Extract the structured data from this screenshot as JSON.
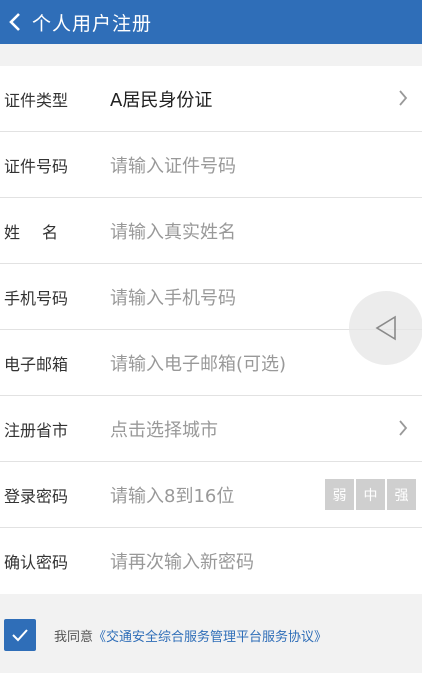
{
  "header": {
    "title": "个人用户注册"
  },
  "form": {
    "rows": [
      {
        "label": "证件类型",
        "value": "A居民身份证"
      },
      {
        "label": "证件号码",
        "placeholder": "请输入证件号码"
      },
      {
        "label": "姓名",
        "placeholder": "请输入真实姓名"
      },
      {
        "label": "手机号码",
        "placeholder": "请输入手机号码"
      },
      {
        "label": "电子邮箱",
        "placeholder": "请输入电子邮箱(可选)"
      },
      {
        "label": "注册省市",
        "placeholder": "点击选择城市"
      },
      {
        "label": "登录密码",
        "placeholder": "请输入8到16位"
      },
      {
        "label": "确认密码",
        "placeholder": "请再次输入新密码"
      }
    ],
    "strength": {
      "weak": "弱",
      "medium": "中",
      "strong": "强"
    }
  },
  "agreement": {
    "prefix": "我同意",
    "link": "《交通安全综合服务管理平台服务协议》",
    "checked": true
  },
  "colors": {
    "accent": "#2f6eb8",
    "background": "#f2f2f2"
  }
}
